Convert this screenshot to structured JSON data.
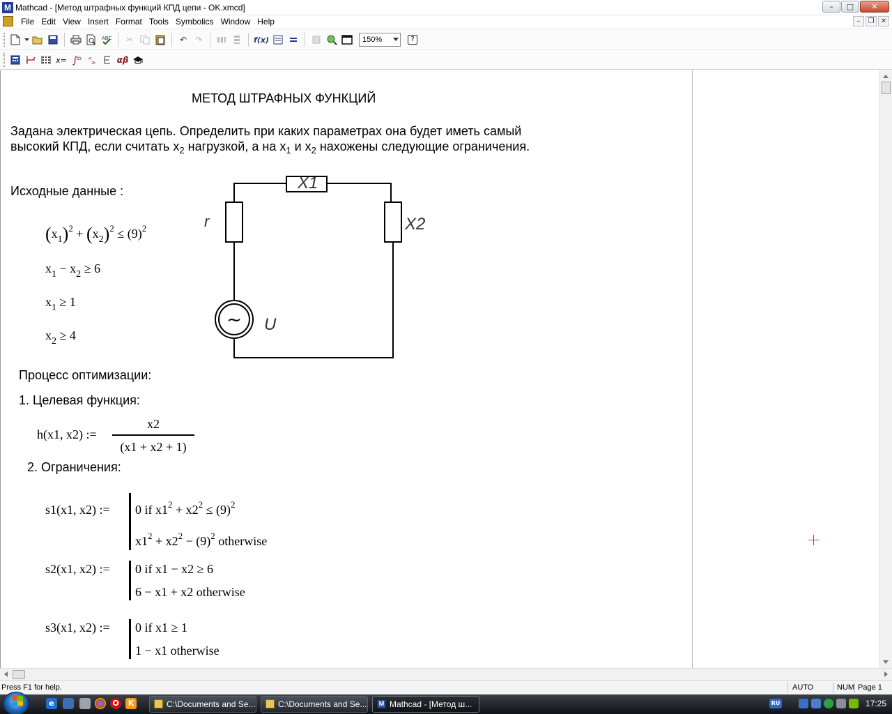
{
  "window": {
    "title": "Mathcad - [Метод штрафных функций КПД цепи - OK.xmcd]",
    "logo": "M",
    "controls": {
      "minimize": "–",
      "maximize": "□",
      "close": "✕"
    }
  },
  "menu": {
    "items": [
      "File",
      "Edit",
      "View",
      "Insert",
      "Format",
      "Tools",
      "Symbolics",
      "Window",
      "Help"
    ],
    "mdi_controls": {
      "minimize": "–",
      "restore": "❐",
      "close": "✕"
    }
  },
  "toolbar": {
    "zoom": "150%",
    "help": "?",
    "fx": "f(x)"
  },
  "math_palette": {
    "x_eq": "x=",
    "alpha_beta": "αβ"
  },
  "document": {
    "title": "МЕТОД ШТРАФНЫХ ФУНКЦИЙ",
    "intro_line1": "Задана электрическая цепь. Определить при каких параметрах она будет иметь самый",
    "intro_line2": {
      "a": "высокий КПД, если считать x",
      "b": "2",
      "c": " нагрузкой, а на x",
      "d": "1",
      "e": " и x",
      "f": "2",
      "g": " нахожены следующие ограничения."
    },
    "source_data_label": "Исходные  данные :",
    "constraints": {
      "c1": {
        "var1": "x",
        "sub1": "1",
        "exp1": "2",
        "plus": "+",
        "var2": "x",
        "sub2": "2",
        "exp2": "2",
        "rel": "≤",
        "rhs": "(9)",
        "exp3": "2"
      },
      "c2": {
        "var1": "x",
        "sub1": "1",
        "minus": "−",
        "var2": "x",
        "sub2": "2",
        "rel": "≥",
        "rhs": "6"
      },
      "c3": {
        "var": "x",
        "sub": "1",
        "rel": "≥",
        "rhs": "1"
      },
      "c4": {
        "var": "x",
        "sub": "2",
        "rel": "≥",
        "rhs": "4"
      }
    },
    "circuit": {
      "label_x1": "X1",
      "label_x2": "X2",
      "label_r": "r",
      "label_u": "U",
      "source_symbol": "~"
    },
    "process_label": "Процесс оптимизации:",
    "step1_label": "1. Целевая функция:",
    "objective": {
      "lhs": "h(x1, x2) :=",
      "numerator": "x2",
      "denominator": "(x1 + x2 + 1)"
    },
    "step2_label": "2. Ограничения:",
    "s1": {
      "lhs": "s1(x1, x2) :=",
      "row1": {
        "a": "0   if  x1",
        "e1": "2",
        "b": " + x2",
        "e2": "2",
        "c": " ≤ (9)",
        "e3": "2"
      },
      "row2": {
        "a": "x1",
        "e1": "2",
        "b": " + x2",
        "e2": "2",
        "c": " − (9)",
        "e3": "2",
        "d": "   otherwise"
      }
    },
    "s2": {
      "lhs": "s2(x1, x2) :=",
      "row1": "0   if  x1 − x2 ≥ 6",
      "row2": "6 − x1 + x2   otherwise"
    },
    "s3": {
      "lhs": "s3(x1, x2) :=",
      "row1": "0   if  x1 ≥ 1",
      "row2": "1 − x1   otherwise"
    }
  },
  "status": {
    "help": "Press F1 for help.",
    "mode": "AUTO",
    "num": "NUM",
    "page": "Page 1"
  },
  "taskbar": {
    "buttons": [
      {
        "label": "C:\\Documents and Se..."
      },
      {
        "label": "C:\\Documents and Se..."
      },
      {
        "label": "Mathcad - [Метод ш..."
      }
    ],
    "tray_lang": "RU",
    "clock": "17:25"
  },
  "colors": {
    "titlebar_bg": "#ffffff",
    "taskbar_bg": "#1b1f24",
    "cursor_mark": "#d23a3a"
  }
}
